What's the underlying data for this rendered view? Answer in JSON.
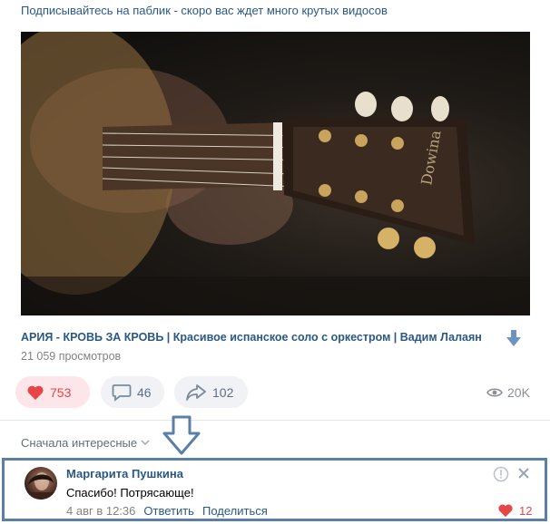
{
  "post": {
    "text": "Подписывайтесь на паблик - скоро вас ждет много крутых видосов"
  },
  "video": {
    "title": "АРИЯ - КРОВЬ ЗА КРОВЬ | Красивое испанское соло с оркестром | Вадим Лалаян",
    "views": "21 059 просмотров"
  },
  "actions": {
    "likes": "753",
    "comments": "46",
    "shares": "102",
    "views": "20K"
  },
  "sort": {
    "label": "Сначала интересные"
  },
  "comment": {
    "author": "Маргарита Пушкина",
    "text": "Спасибо! Потрясающе!",
    "date": "4 авг в 12:36",
    "reply_label": "Ответить",
    "share_label": "Поделиться",
    "likes": "12"
  },
  "colors": {
    "link": "#2a5885",
    "like_red": "#e64646",
    "annotation_blue": "#5b7fa8"
  }
}
